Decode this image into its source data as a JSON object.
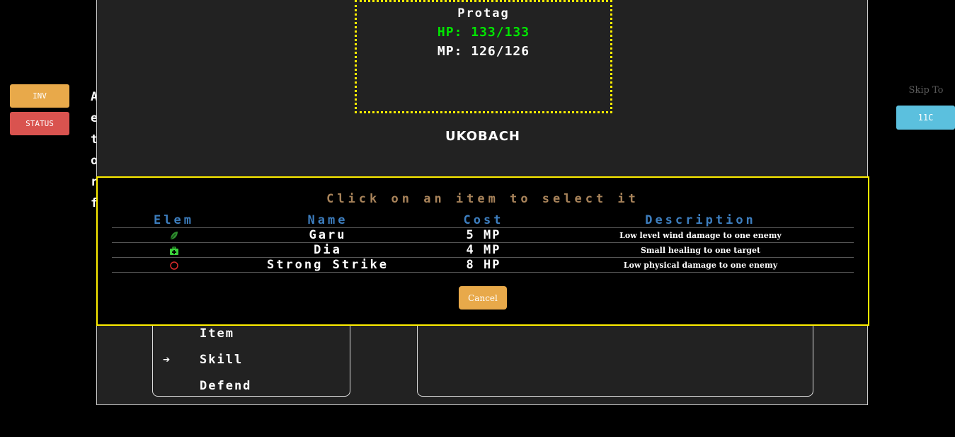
{
  "side_buttons": {
    "inv": "INV",
    "status": "STATUS"
  },
  "background_letters": [
    "A",
    "e",
    "t",
    "o",
    "r",
    "f"
  ],
  "skip": {
    "label": "Skip To",
    "button": "11C"
  },
  "player": {
    "name": "Protag",
    "hp": "HP: 133/133",
    "mp": "MP: 126/126"
  },
  "enemy": {
    "name": "UKOBACH"
  },
  "commands": {
    "item": "Item",
    "skill": "Skill",
    "defend": "Defend"
  },
  "skill_modal": {
    "title": "Click on an item to select it",
    "headers": {
      "elem": "Elem",
      "name": "Name",
      "cost": "Cost",
      "desc": "Description"
    },
    "skills": [
      {
        "element": "leaf-icon",
        "name": "Garu",
        "cost": "5 MP",
        "desc": "Low level wind damage to one enemy"
      },
      {
        "element": "medkit-icon",
        "name": "Dia",
        "cost": "4 MP",
        "desc": "Small healing to one target"
      },
      {
        "element": "circle-icon",
        "name": "Strong Strike",
        "cost": "8 HP",
        "desc": "Low physical damage to one enemy"
      }
    ],
    "cancel": "Cancel"
  },
  "colors": {
    "hp": "#00e600",
    "modal_border": "#ffef00",
    "header": "#3d7ebf",
    "title": "#a8835a",
    "inv": "#e8a94a",
    "status": "#d9534f",
    "skip": "#5bc0de"
  }
}
